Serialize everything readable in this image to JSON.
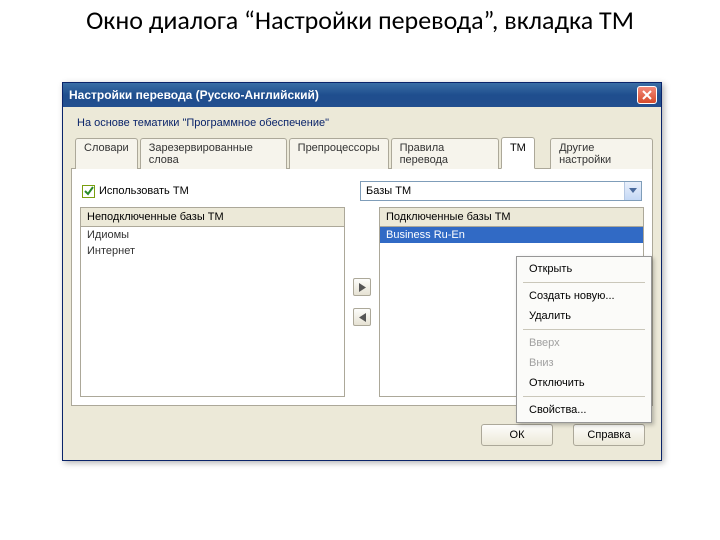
{
  "slide": {
    "title": "Окно диалога “Настройки перевода”, вкладка ТМ"
  },
  "window": {
    "title": "Настройки перевода (Русско-Английский)",
    "subtitle": "На основе тематики \"Программное обеспечение\""
  },
  "tabs": {
    "items": [
      "Словари",
      "Зарезервированные слова",
      "Препроцессоры",
      "Правила перевода",
      "ТМ",
      "Другие настройки"
    ],
    "active": "ТМ"
  },
  "tm": {
    "use_tm_label": "Использовать ТМ",
    "db_dropdown_label": "Базы ТМ",
    "unconnected_header": "Неподключенные базы ТМ",
    "connected_header": "Подключенные базы ТМ",
    "unconnected_items": [
      "Идиомы",
      "Интернет"
    ],
    "connected_items": [
      "Business Ru-En"
    ]
  },
  "context_menu": {
    "open": "Открыть",
    "create": "Создать новую...",
    "delete": "Удалить",
    "up": "Вверх",
    "down": "Вниз",
    "disconnect": "Отключить",
    "properties": "Свойства..."
  },
  "footer": {
    "ok": "ОК",
    "help": "Справка"
  }
}
